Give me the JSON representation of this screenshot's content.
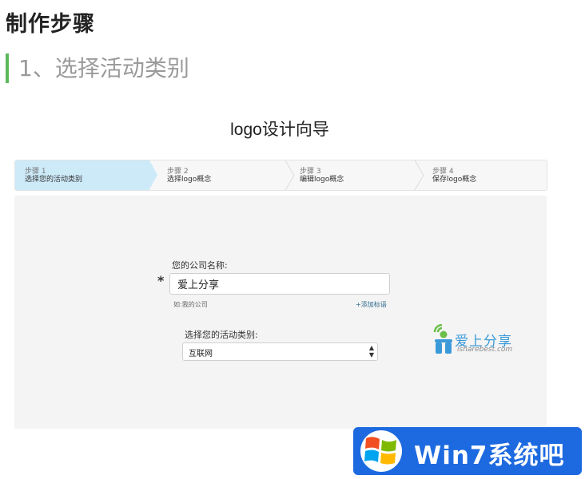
{
  "article": {
    "heading": "制作步骤",
    "subheading": "1、选择活动类别"
  },
  "wizard": {
    "title": "logo设计向导",
    "steps": [
      {
        "number": "步骤 1",
        "label": "选择您的活动类别",
        "active": true
      },
      {
        "number": "步骤 2",
        "label": "选择logo概念",
        "active": false
      },
      {
        "number": "步骤 3",
        "label": "编辑logo概念",
        "active": false
      },
      {
        "number": "步骤 4",
        "label": "保存logo概念",
        "active": false
      }
    ],
    "company": {
      "label": "您的公司名称:",
      "required_mark": "*",
      "value": "爱上分享",
      "hint": "如:我的公司",
      "add_tagline": "+添加标语"
    },
    "category": {
      "label": "选择您的活动类别:",
      "selected": "互联网"
    },
    "logo_preview": {
      "name": "爱上分享",
      "domain": "isharebest.com"
    }
  },
  "watermark": {
    "text": "Win7系统吧"
  },
  "colors": {
    "accent_bar": "#5cb85c",
    "active_step": "#cdeaf9",
    "link": "#2e6b8e",
    "logo_blue": "#3a9ad9",
    "watermark_bg": "#1d6ae0"
  }
}
